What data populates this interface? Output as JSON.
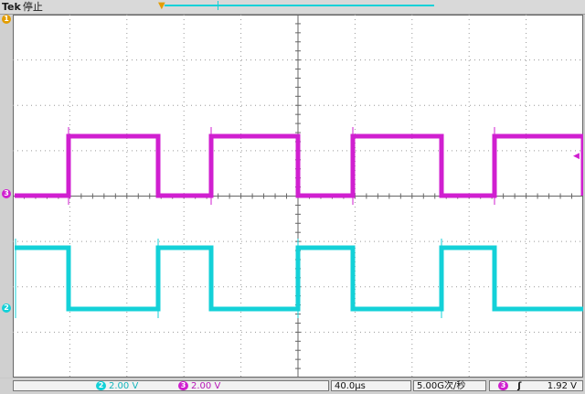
{
  "header": {
    "brand": "Tek",
    "acq_state": "停止"
  },
  "channels": {
    "ch1": {
      "number": "1",
      "color": "#e39d00"
    },
    "ch2": {
      "number": "2",
      "scale": "2.00 V",
      "color": "#13d1d8"
    },
    "ch3": {
      "number": "3",
      "scale": "2.00 V",
      "color": "#d01fd0"
    }
  },
  "timebase": {
    "scale": "40.0µs"
  },
  "sample_rate": {
    "value": "5.00G次/秒"
  },
  "trigger": {
    "source": "3",
    "slope_symbol": "ʃ",
    "level": "1.92 V"
  },
  "waveforms": {
    "ch3_high_segments": [
      [
        75,
        173
      ],
      [
        231,
        326
      ],
      [
        386,
        483
      ],
      [
        541,
        638
      ]
    ],
    "ch2_high_segments": [
      [
        17,
        75
      ],
      [
        173,
        231
      ],
      [
        326,
        386
      ],
      [
        483,
        541
      ]
    ]
  }
}
